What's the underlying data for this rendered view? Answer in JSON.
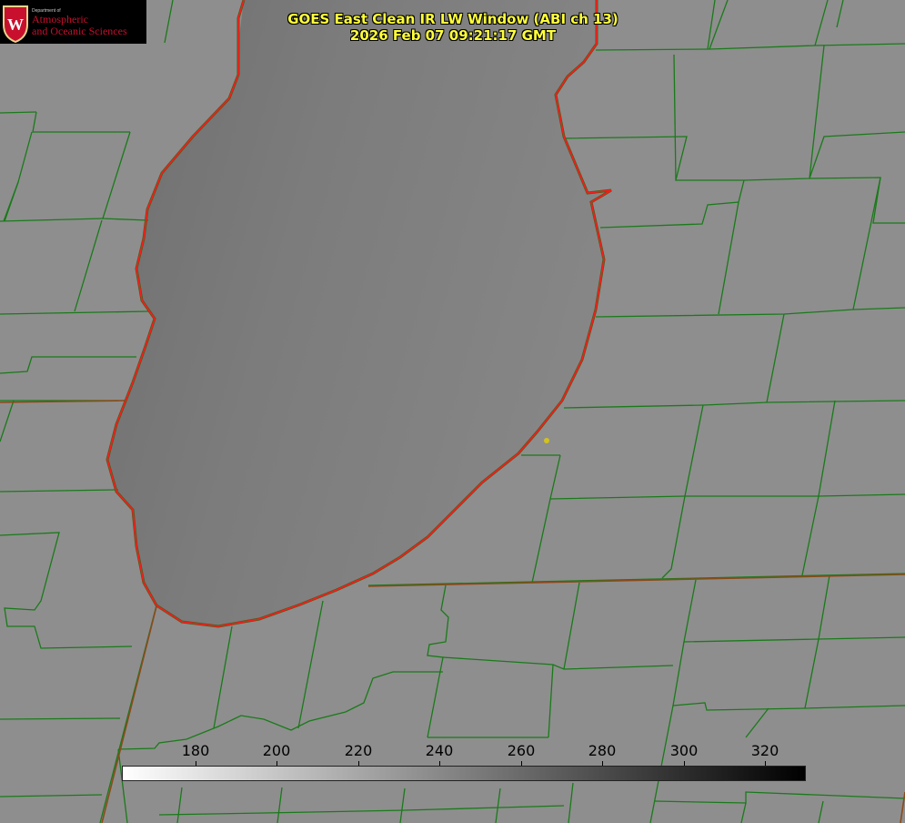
{
  "header": {
    "title_line1": "GOES East Clean IR LW Window (ABI ch 13)",
    "title_line2": "2026 Feb 07 09:21:17 GMT"
  },
  "logo": {
    "dept_small": "Department of",
    "line1": "Atmospheric",
    "line2": "and Oceanic Sciences",
    "accent_color": "#c8102e"
  },
  "colorbar": {
    "ticks": [
      "180",
      "200",
      "220",
      "240",
      "260",
      "280",
      "300",
      "320"
    ],
    "range": [
      162,
      330
    ],
    "color_low": "#ffffff",
    "color_high": "#000000"
  },
  "map": {
    "land_color": "#8e8e8e",
    "lake_color": "#7a7a7a",
    "coastline_color": "#ff1a1a",
    "boundary_color": "#1a7a1a",
    "marker_color": "#d4c21a"
  }
}
